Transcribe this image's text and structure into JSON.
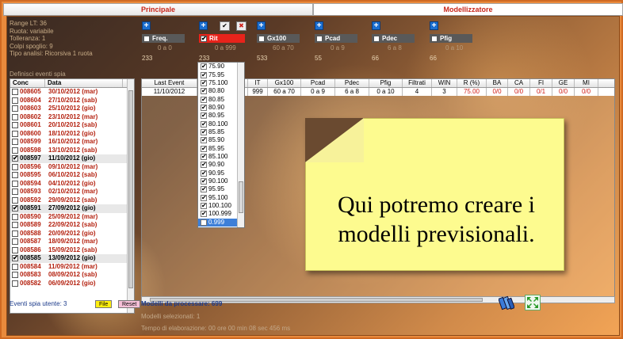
{
  "tabs": [
    {
      "label": "Principale"
    },
    {
      "label": "Modellizzatore"
    }
  ],
  "info": {
    "range": "Range LT: 36",
    "ruota": "Ruota: variabile",
    "tolleranza": "Tolleranza: 1",
    "colpi": "Colpi spoglio: 9",
    "tipo": "Tipo analisi: Ricorsiva 1 ruota",
    "section": "Definisci eventi spia"
  },
  "filters": [
    {
      "label": "Freq.",
      "range": "0 a 0",
      "value": "233",
      "checked": false
    },
    {
      "label": "Rit",
      "range": "0 a 999",
      "value": "233",
      "checked": true
    },
    {
      "label": "Gx100",
      "range": "60 a 70",
      "value": "533",
      "checked": false
    },
    {
      "label": "Pcad",
      "range": "0 a 9",
      "value": "55",
      "checked": false
    },
    {
      "label": "Pdec",
      "range": "6 a 8",
      "value": "66",
      "checked": false
    },
    {
      "label": "Pfig",
      "range": "0 a 10",
      "value": "66",
      "checked": false
    }
  ],
  "left_table": {
    "headers": [
      "Conc",
      "Data"
    ],
    "rows": [
      {
        "conc": "008605",
        "data": "30/10/2012 (mar)",
        "checked": false
      },
      {
        "conc": "008604",
        "data": "27/10/2012 (sab)",
        "checked": false
      },
      {
        "conc": "008603",
        "data": "25/10/2012 (gio)",
        "checked": false
      },
      {
        "conc": "008602",
        "data": "23/10/2012 (mar)",
        "checked": false
      },
      {
        "conc": "008601",
        "data": "20/10/2012 (sab)",
        "checked": false
      },
      {
        "conc": "008600",
        "data": "18/10/2012 (gio)",
        "checked": false
      },
      {
        "conc": "008599",
        "data": "16/10/2012 (mar)",
        "checked": false
      },
      {
        "conc": "008598",
        "data": "13/10/2012 (sab)",
        "checked": false
      },
      {
        "conc": "008597",
        "data": "11/10/2012 (gio)",
        "checked": true
      },
      {
        "conc": "008596",
        "data": "09/10/2012 (mar)",
        "checked": false
      },
      {
        "conc": "008595",
        "data": "06/10/2012 (sab)",
        "checked": false
      },
      {
        "conc": "008594",
        "data": "04/10/2012 (gio)",
        "checked": false
      },
      {
        "conc": "008593",
        "data": "02/10/2012 (mar)",
        "checked": false
      },
      {
        "conc": "008592",
        "data": "29/09/2012 (sab)",
        "checked": false
      },
      {
        "conc": "008591",
        "data": "27/09/2012 (gio)",
        "checked": true
      },
      {
        "conc": "008590",
        "data": "25/09/2012 (mar)",
        "checked": false
      },
      {
        "conc": "008589",
        "data": "22/09/2012 (sab)",
        "checked": false
      },
      {
        "conc": "008588",
        "data": "20/09/2012 (gio)",
        "checked": false
      },
      {
        "conc": "008587",
        "data": "18/09/2012 (mar)",
        "checked": false
      },
      {
        "conc": "008586",
        "data": "15/09/2012 (sab)",
        "checked": false
      },
      {
        "conc": "008585",
        "data": "13/09/2012 (gio)",
        "checked": true
      },
      {
        "conc": "008584",
        "data": "11/09/2012 (mar)",
        "checked": false
      },
      {
        "conc": "008583",
        "data": "08/09/2012 (sab)",
        "checked": false
      },
      {
        "conc": "008582",
        "data": "06/09/2012 (gio)",
        "checked": false
      }
    ]
  },
  "main_table": {
    "headers": [
      "Last Event",
      "",
      "IT",
      "Gx100",
      "Pcad",
      "Pdec",
      "Pfig",
      "Filtrati",
      "WIN",
      "R (%)",
      "BA",
      "CA",
      "FI",
      "GE",
      "MI"
    ],
    "row": [
      "11/10/2012",
      "",
      "999",
      "60 a 70",
      "0 a 9",
      "6 a 8",
      "0 a 10",
      "4",
      "3",
      "75.00",
      "0/0",
      "0/0",
      "0/1",
      "0/0",
      "0/0"
    ]
  },
  "dropdown": {
    "items": [
      "75.90",
      "75.95",
      "75.100",
      "80.80",
      "80.85",
      "80.90",
      "80.95",
      "80.100",
      "85.85",
      "85.90",
      "85.95",
      "85.100",
      "90.90",
      "90.95",
      "90.100",
      "95.95",
      "95.100",
      "100.100",
      "100.999",
      "0.999"
    ],
    "highlighted": "0.999"
  },
  "note": {
    "line1": "Qui potremo creare i",
    "line2": "modelli previsionali."
  },
  "footer": {
    "eventi": "Eventi spia utente: 3",
    "file_btn": "File",
    "reset_btn": "Reset",
    "modelli": "Modelli da processare: 699",
    "selezionati": "Modelli selezionati: 1",
    "tempo": "Tempo di elaborazione: 00 ore 00 min 08 sec 456 ms"
  },
  "colors": {
    "accent": "#e8231b",
    "frame": "#e98a3c",
    "note": "#fdfb8f",
    "link": "#1b3a8a"
  }
}
